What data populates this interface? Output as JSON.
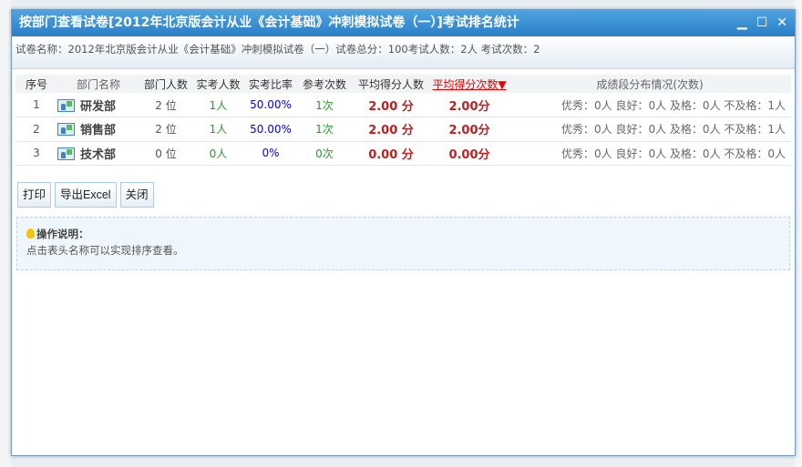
{
  "dialog": {
    "title": "按部门查看试卷[2012年北京版会计从业《会计基础》冲刺模拟试卷（一）]考试排名统计",
    "info": "试卷名称：2012年北京版会计从业《会计基础》冲刺模拟试卷（一）试卷总分：100考试人数：2人 考试次数：2"
  },
  "table": {
    "headers": [
      "序号",
      "部门名称",
      "部门人数",
      "实考人数",
      "实考比率",
      "参考次数",
      "平均得分人数",
      "平均得分次数▼",
      "成绩段分布情况(次数)"
    ],
    "rows": [
      {
        "no": "1",
        "dept": "研发部",
        "members": "2 位",
        "actual": "1人",
        "ratio": "50.00%",
        "times": "1次",
        "avg_person": "2.00 分",
        "avg_times": "2.00分",
        "dist": "优秀：0人 良好：0人 及格：0人 不及格：1人"
      },
      {
        "no": "2",
        "dept": "销售部",
        "members": "2 位",
        "actual": "1人",
        "ratio": "50.00%",
        "times": "1次",
        "avg_person": "2.00 分",
        "avg_times": "2.00分",
        "dist": "优秀：0人 良好：0人 及格：0人 不及格：1人"
      },
      {
        "no": "3",
        "dept": "技术部",
        "members": "0 位",
        "actual": "0人",
        "ratio": "0%",
        "times": "0次",
        "avg_person": "0.00 分",
        "avg_times": "0.00分",
        "dist": "优秀：0人 良好：0人 及格：0人 不及格：0人"
      }
    ]
  },
  "buttons": {
    "print": "打印",
    "export": "导出Excel",
    "close": "关闭"
  },
  "note": {
    "title": "操作说明：",
    "text": "点击表头名称可以实现排序查看。"
  },
  "window": {
    "minimize": "▁",
    "maximize": "☐",
    "close": "✕"
  }
}
